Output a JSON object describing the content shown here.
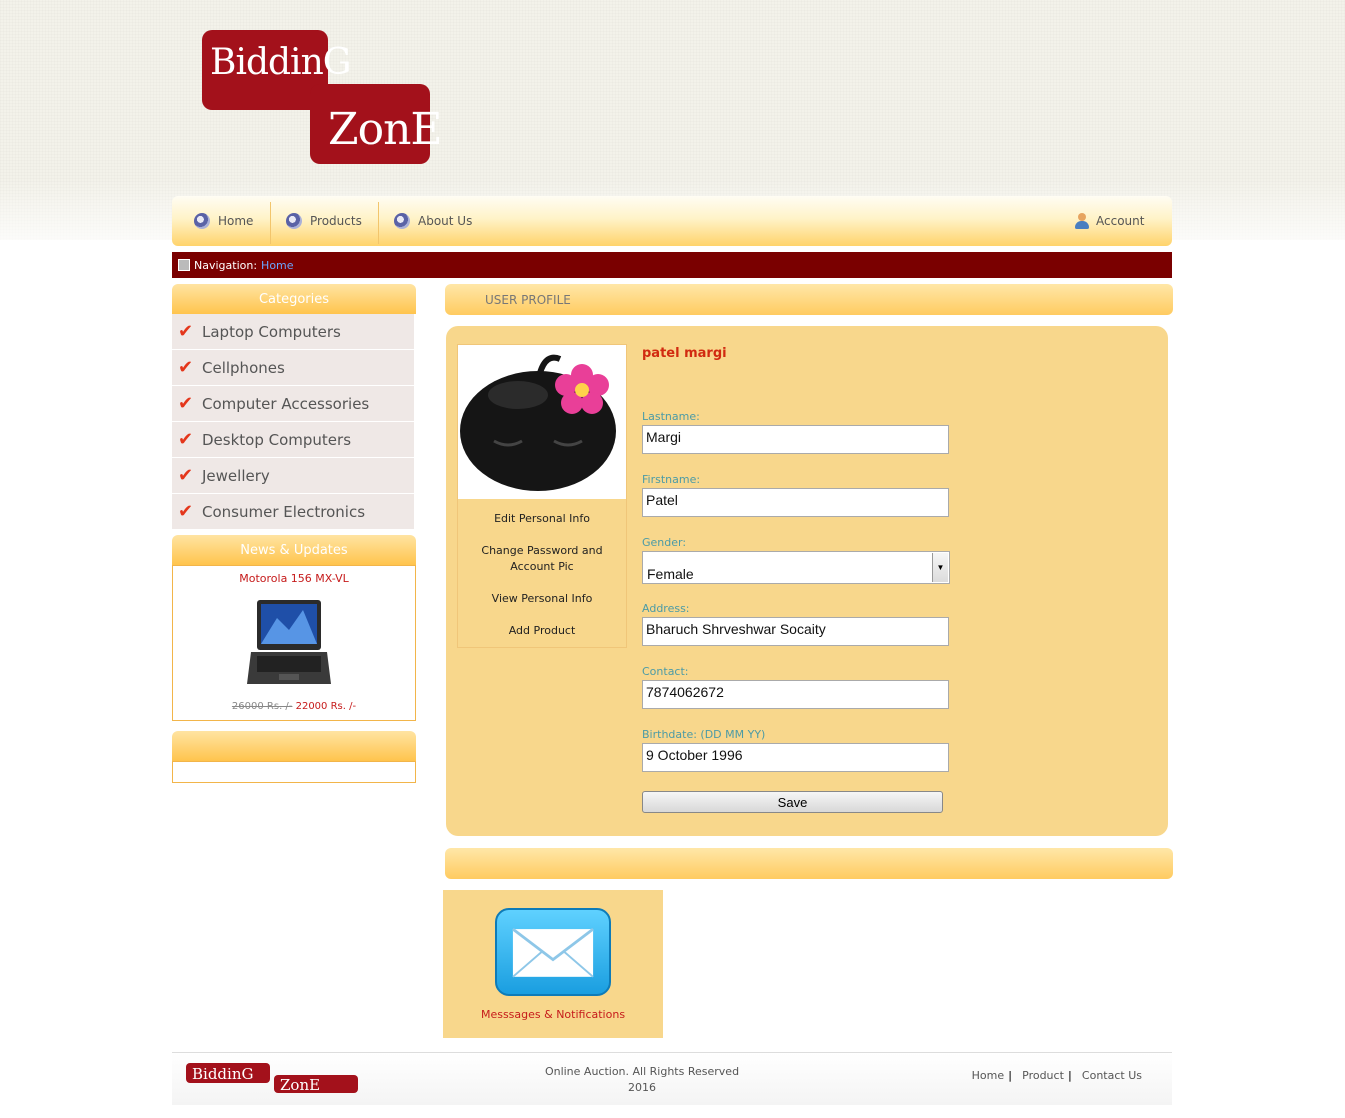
{
  "brand": {
    "logo_line1": "BiddinG",
    "logo_line2": "ZonE"
  },
  "topnav": {
    "home": "Home",
    "products": "Products",
    "about": "About Us",
    "account": "Account"
  },
  "breadcrumb": {
    "label": "Navigation:",
    "current": "Home"
  },
  "categories": {
    "title": "Categories",
    "items": [
      "Laptop Computers",
      "Cellphones",
      "Computer Accessories",
      "Desktop Computers",
      "Jewellery",
      "Consumer Electronics"
    ]
  },
  "news": {
    "title": "News & Updates",
    "product_name": "Motorola 156 MX-VL",
    "old_price": "26000 Rs. /-",
    "new_price": "22000 Rs. /-"
  },
  "profile": {
    "heading": "USER PROFILE",
    "display_name": "patel margi",
    "side_links": [
      "Edit Personal Info",
      "Change Password and Account Pic",
      "View Personal Info",
      "Add Product"
    ],
    "fields": {
      "lastname_label": "Lastname:",
      "lastname_value": "Margi",
      "firstname_label": "Firstname:",
      "firstname_value": "Patel",
      "gender_label": "Gender:",
      "gender_value": "Female",
      "address_label": "Address:",
      "address_value": "Bharuch Shrveshwar Socaity",
      "contact_label": "Contact:",
      "contact_value": "7874062672",
      "birthdate_label": "Birthdate: (DD MM YY)",
      "birthdate_value": "9 October 1996"
    },
    "save_label": "Save"
  },
  "messages": {
    "label": "Messsages & Notifications"
  },
  "footer": {
    "copyright": "Online Auction. All Rights Reserved",
    "year": "2016",
    "links": [
      "Home",
      "Product",
      "Contact Us"
    ]
  },
  "colors": {
    "accent": "#a3111b",
    "nav_gradient_end": "#ffc44d",
    "panel": "#f8d78c",
    "breadcrumb_bg": "#7a0000"
  }
}
